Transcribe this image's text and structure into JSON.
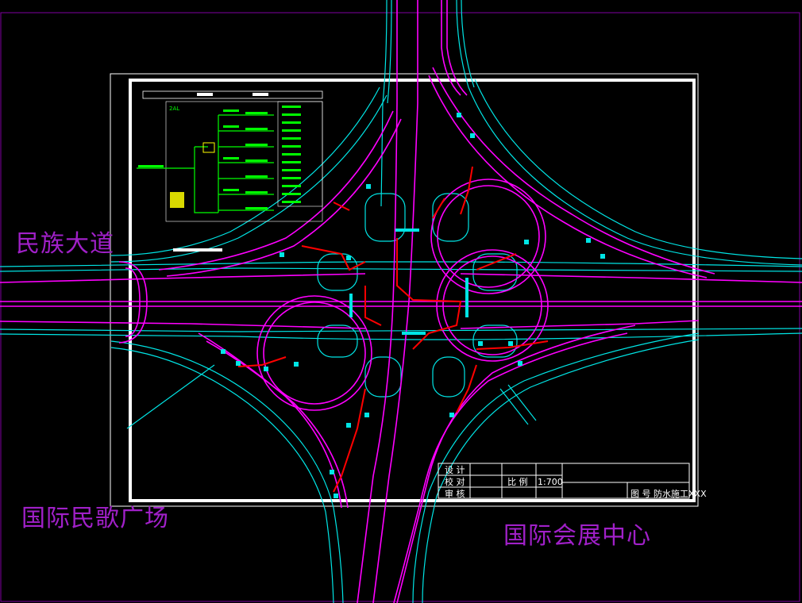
{
  "place_labels": {
    "top_left": "民族大道",
    "bottom_left": "国际民歌广场",
    "bottom_right": "国际会展中心"
  },
  "title_block": {
    "design": "设 计",
    "check": "校 对",
    "review": "审 核",
    "scale_label": "比 例",
    "scale_value": "1:700",
    "drawing_name": "图   号  防水施工XXX"
  },
  "schematic": {
    "panel_label": "2AL"
  },
  "colors": {
    "background": "#000000",
    "road_edge": "#00e5e5",
    "ramp": "#ff00ff",
    "lighting_cable": "#ff0000",
    "frame": "#ffffff",
    "outer_border": "#8000a0",
    "label": "#a020c8",
    "schematic_wire": "#00ff00",
    "schematic_panel": "#ffff00"
  }
}
